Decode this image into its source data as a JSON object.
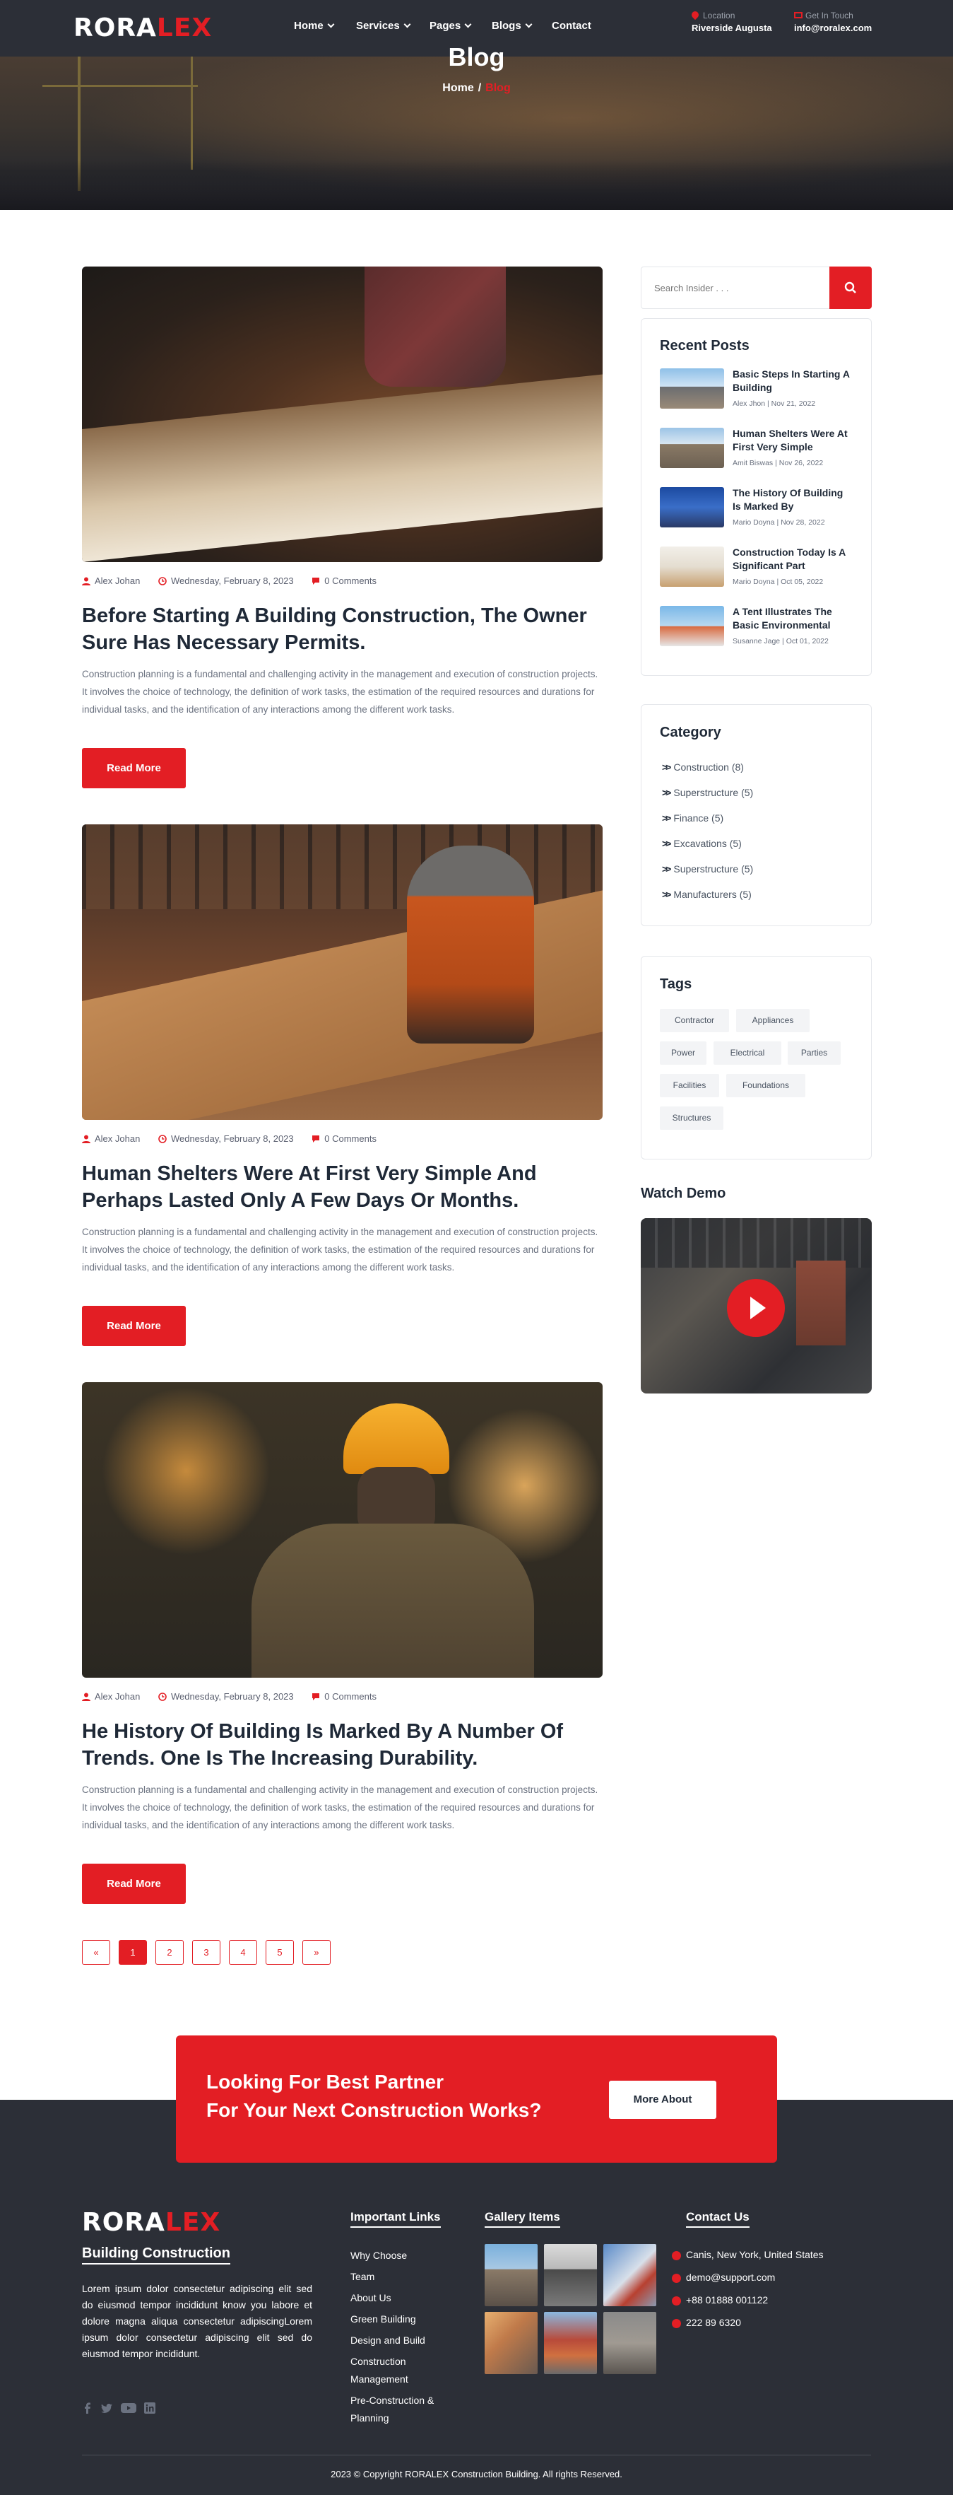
{
  "header": {
    "logo_main": "RORA",
    "logo_accent": "LEX",
    "nav": [
      {
        "label": "Home",
        "has_dropdown": true
      },
      {
        "label": "Services",
        "has_dropdown": true
      },
      {
        "label": "Pages",
        "has_dropdown": true
      },
      {
        "label": "Blogs",
        "has_dropdown": true
      },
      {
        "label": "Contact",
        "has_dropdown": false
      }
    ],
    "location_label": "Location",
    "location_value": "Riverside Augusta",
    "contact_label": "Get In Touch",
    "contact_value": "info@roralex.com"
  },
  "banner": {
    "title": "Blog",
    "breadcrumb_home": "Home",
    "breadcrumb_sep": "/",
    "breadcrumb_current": "Blog"
  },
  "posts": [
    {
      "author": "Alex Johan",
      "date": "Wednesday, February 8, 2023",
      "comments": "0 Comments",
      "title": "Before Starting A Building Construction, The Owner Sure Has Necessary Permits.",
      "excerpt": "Construction planning is a fundamental and challenging activity in the management and execution of construction projects. It involves the choice of technology, the definition of work tasks, the estimation of the required resources and durations for individual tasks, and the identification of any interactions among the different work tasks.",
      "button": "Read More"
    },
    {
      "author": "Alex Johan",
      "date": "Wednesday, February 8, 2023",
      "comments": "0 Comments",
      "title": "Human Shelters Were At First Very Simple And Perhaps Lasted Only A Few Days Or Months.",
      "excerpt": "Construction planning is a fundamental and challenging activity in the management and execution of construction projects. It involves the choice of technology, the definition of work tasks, the estimation of the required resources and durations for individual tasks, and the identification of any interactions among the different work tasks.",
      "button": "Read More"
    },
    {
      "author": "Alex Johan",
      "date": "Wednesday, February 8, 2023",
      "comments": "0 Comments",
      "title": "He History Of Building Is Marked By A Number Of Trends. One Is The Increasing Durability.",
      "excerpt": "Construction planning is a fundamental and challenging activity in the management and execution of construction projects. It involves the choice of technology, the definition of work tasks, the estimation of the required resources and durations for individual tasks, and the identification of any interactions among the different work tasks.",
      "button": "Read More"
    }
  ],
  "pagination": {
    "prev": "«",
    "pages": [
      "1",
      "2",
      "3",
      "4",
      "5"
    ],
    "next": "»",
    "current": "1"
  },
  "sidebar": {
    "search_placeholder": "Search Insider . . .",
    "recent_title": "Recent Posts",
    "recent": [
      {
        "title": "Basic Steps In Starting A Building",
        "meta": "Alex Jhon | Nov 21, 2022"
      },
      {
        "title": "Human Shelters Were At First Very Simple",
        "meta": "Amit Biswas | Nov 26, 2022"
      },
      {
        "title": "The History Of Building Is Marked By",
        "meta": "Mario Doyna | Nov 28, 2022"
      },
      {
        "title": "Construction Today Is A Significant Part",
        "meta": "Mario Doyna | Oct 05, 2022"
      },
      {
        "title": "A Tent Illustrates The Basic Environmental",
        "meta": "Susanne Jage | Oct 01, 2022"
      }
    ],
    "category_title": "Category",
    "categories": [
      "Construction (8)",
      "Superstructure (5)",
      "Finance (5)",
      "Excavations (5)",
      "Superstructure (5)",
      "Manufacturers (5)"
    ],
    "tags_title": "Tags",
    "tags": [
      "Contractor",
      "Appliances",
      "Power",
      "Electrical",
      "Parties",
      "Facilities",
      "Foundations",
      "Structures"
    ],
    "watch_title": "Watch Demo"
  },
  "cta": {
    "line1": "Looking For Best Partner",
    "line2": "For Your Next Construction Works?",
    "button": "More About"
  },
  "footer": {
    "logo_main": "RORA",
    "logo_accent": "LEX",
    "tagline": "Building Construction",
    "description": "Lorem ipsum dolor consectetur adipiscing elit sed do eiusmod tempor incididunt know you labore et dolore magna aliqua consectetur adipiscingLorem ipsum dolor consectetur adipiscing elit sed do eiusmod tempor incididunt.",
    "links_title": "Important Links",
    "links": [
      "Why Choose",
      "Team",
      "About Us",
      "Green Building",
      "Design and Build",
      "Construction",
      "Management",
      "Pre-Construction &",
      "Planning"
    ],
    "gallery_title": "Gallery Items",
    "contact_title": "Contact Us",
    "contacts": [
      "Canis, New York, United States",
      "demo@support.com",
      "+88 01888 001122",
      "222 89 6320"
    ],
    "copyright": "2023 © Copyright RORALEX Construction Building. All rights Reserved."
  },
  "colors": {
    "accent": "#e31e24",
    "dark": "#2c2f37",
    "heading": "#1f2937"
  },
  "icons": [
    "user-icon",
    "clock-icon",
    "comment-icon",
    "search-icon",
    "double-chevron-icon",
    "play-icon",
    "facebook-icon",
    "twitter-icon",
    "youtube-icon",
    "linkedin-icon",
    "location-icon",
    "email-icon",
    "phone-icon"
  ]
}
